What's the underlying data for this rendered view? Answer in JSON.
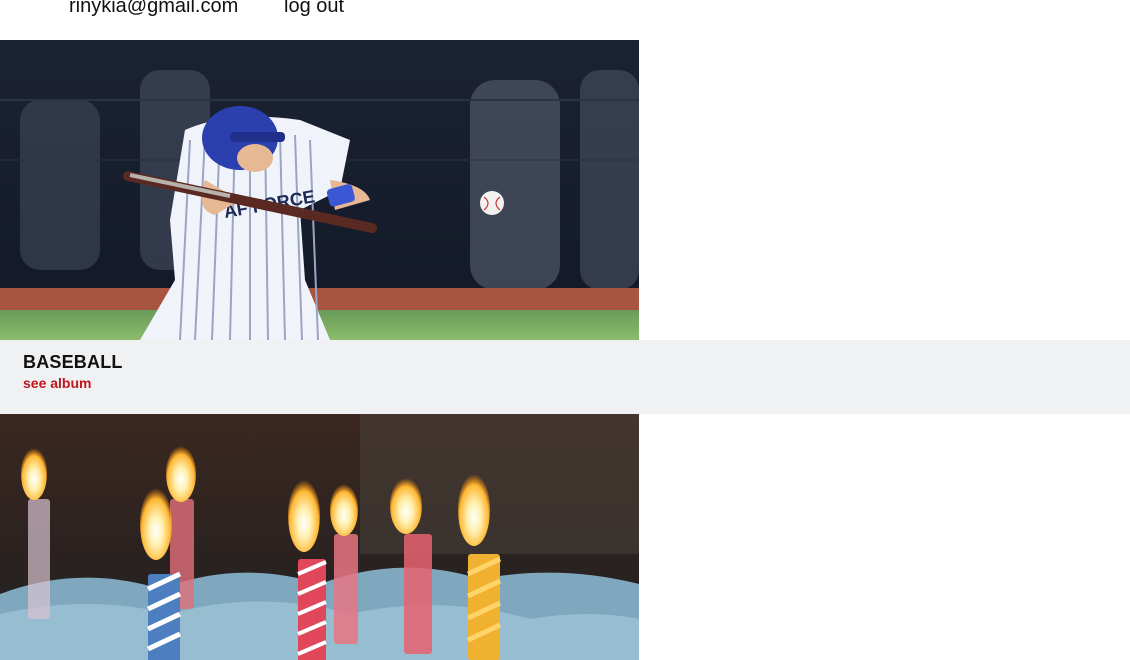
{
  "header": {
    "user_email": "rinykia@gmail.com",
    "logout_label": "log out"
  },
  "albums": [
    {
      "title": "BASEBALL",
      "link_label": "see album",
      "photo": "baseball-player-bunting-photo"
    },
    {
      "photo": "birthday-candles-photo"
    }
  ],
  "colors": {
    "album_bar_bg": "#f0f1f3",
    "link_red": "#c0161b",
    "text_dark": "#111111"
  }
}
